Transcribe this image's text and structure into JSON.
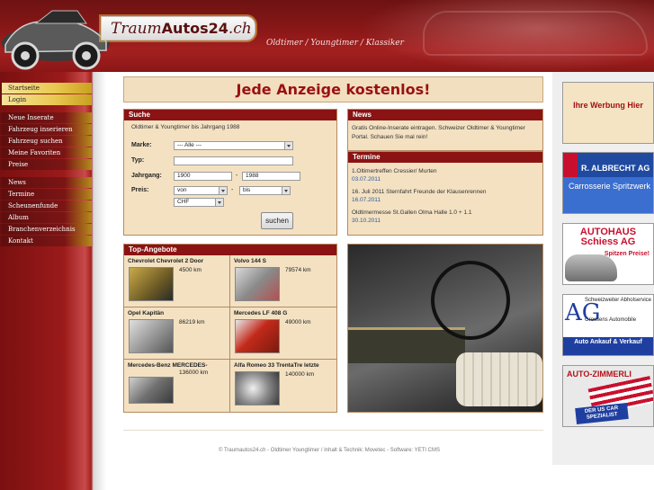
{
  "header": {
    "logo_light": "Traum",
    "logo_bold": "Autos24",
    "logo_tld": ".ch",
    "tagline": "Oldtimer  /  Youngtimer  /  Klassiker"
  },
  "nav": {
    "group1": [
      {
        "label": "Startseite",
        "highlight": true
      },
      {
        "label": "Login",
        "highlight": true
      }
    ],
    "group2": [
      {
        "label": "Neue Inserate"
      },
      {
        "label": "Fahrzeug inserieren"
      },
      {
        "label": "Fahrzeug suchen"
      },
      {
        "label": "Meine Favoriten"
      },
      {
        "label": "Preise"
      }
    ],
    "group3": [
      {
        "label": "News"
      },
      {
        "label": "Termine"
      },
      {
        "label": "Scheunenfunde"
      },
      {
        "label": "Album"
      },
      {
        "label": "Branchenverzeichnis"
      },
      {
        "label": "Kontakt"
      }
    ]
  },
  "banner": "Jede Anzeige kostenlos!",
  "search": {
    "title": "Suche",
    "intro": "Oldtimer & Youngtimer bis Jahrgang 1988",
    "marke_label": "Marke:",
    "marke_value": "--- Alle ---",
    "typ_label": "Typ:",
    "typ_value": "",
    "jahrgang_label": "Jahrgang:",
    "jahrgang_from": "1900",
    "jahrgang_sep": "-",
    "jahrgang_to": "1988",
    "preis_label": "Preis:",
    "preis_from": "von",
    "preis_sep": "-",
    "preis_to": "bis",
    "currency": "CHF",
    "button": "suchen"
  },
  "news": {
    "title": "News",
    "text": "Gratis Online-Inserate eintragen. Schweizer Oldtimer & Youngtimer Portal. Schauen Sie mal rein!"
  },
  "termine": {
    "title": "Termine",
    "events": [
      {
        "title": "1.Oltimertreffen Cressier/ Murten",
        "date": "03.07.2011"
      },
      {
        "title": "16. Juli 2011 Sternfahrt Freunde der Klausenrennen",
        "date": "16.07.2011"
      },
      {
        "title": "Oldtimermesse St.Gallen Olma Halle 1.0 + 1.1",
        "date": "30.10.2011"
      }
    ]
  },
  "top": {
    "title": "Top-Angebote",
    "items": [
      {
        "name": "Chevrolet Chevrolet 2 Door",
        "km": "4500 km"
      },
      {
        "name": "Volvo 144 S",
        "km": "79574 km"
      },
      {
        "name": "Opel Kapitän",
        "km": "86219 km"
      },
      {
        "name": "Mercedes LF 408 G",
        "km": "49000 km"
      },
      {
        "name": "Mercedes-Benz MERCEDES-",
        "km": "136000 km"
      },
      {
        "name": "Alfa Romeo 33 TrentaTre letzte",
        "km": "140000 km"
      }
    ]
  },
  "ads": {
    "ad1": "Ihre Werbung Hier",
    "ad2_title": "R. ALBRECHT AG",
    "ad2_sub": "Carrosserie Spritzwerk",
    "ad3_title": "AUTOHAUS Schiess AG",
    "ad3_sub": "Spitzen Preise!",
    "ad4_logo": "AG",
    "ad4_top": "Schweizweiter Abholservice",
    "ad4_mid": "Grossens Automobile",
    "ad4_bottom": "Auto Ankauf & Verkauf",
    "ad5_title": "AUTO-ZIMMERLI",
    "ad5_sub": "DER US CAR SPEZIALIST"
  },
  "footer": "© Traumautos24.ch - Oldtimer Youngtimer / Inhalt & Technik: Movetec - Software: YETI CMS",
  "colors": {
    "brand_red": "#8b1313",
    "panel_bg": "#f3e1c2",
    "nav_highlight": "#e9c850",
    "link_blue": "#2a5aa0"
  }
}
